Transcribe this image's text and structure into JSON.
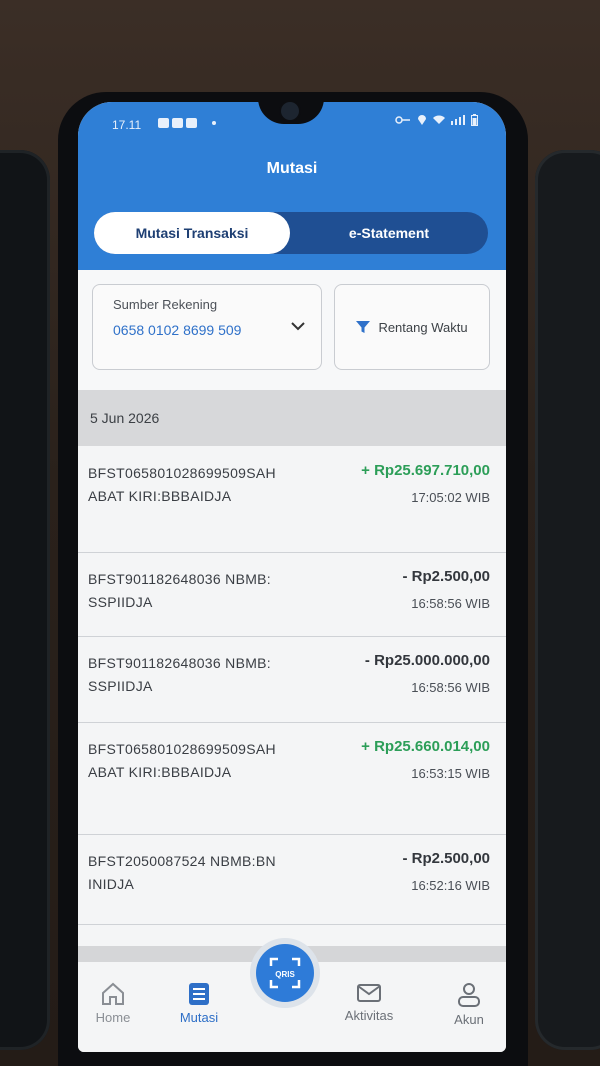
{
  "status_bar": {
    "time": "17.11"
  },
  "header": {
    "title": "Mutasi"
  },
  "tabs": [
    {
      "label": "Mutasi Transaksi",
      "active": true
    },
    {
      "label": "e-Statement",
      "active": false
    }
  ],
  "filters": {
    "source_label": "Sumber Rekening",
    "source_value": "0658 0102 8699 509",
    "range_label": "Rentang Waktu"
  },
  "date_header": "5 Jun 2026",
  "transactions": [
    {
      "desc": "BFST065801028699509SAHABAT KIRI:BBBAIDJA",
      "amount": "+ Rp25.697.710,00",
      "type": "credit",
      "time": "17:05:02 WIB"
    },
    {
      "desc": "BFST901182648036 NBMB:SSPIIDJA",
      "amount": "- Rp2.500,00",
      "type": "debit",
      "time": "16:58:56 WIB"
    },
    {
      "desc": "BFST901182648036 NBMB:SSPIIDJA",
      "amount": "- Rp25.000.000,00",
      "type": "debit",
      "time": "16:58:56 WIB"
    },
    {
      "desc": "BFST065801028699509SAHABAT KIRI:BBBAIDJA",
      "amount": "+ Rp25.660.014,00",
      "type": "credit",
      "time": "16:53:15 WIB"
    },
    {
      "desc": "BFST2050087524 NBMB:BNINIDJA",
      "amount": "- Rp2.500,00",
      "type": "debit",
      "time": "16:52:16 WIB"
    }
  ],
  "nav": {
    "home": "Home",
    "mutasi": "Mutasi",
    "qris": "QRIS",
    "aktivitas": "Aktivitas",
    "akun": "Akun"
  },
  "colors": {
    "header_blue": "#2f7fd6",
    "tab_dark": "#1f4f93",
    "credit_green": "#2c9e58",
    "link_blue": "#2f71c9"
  }
}
